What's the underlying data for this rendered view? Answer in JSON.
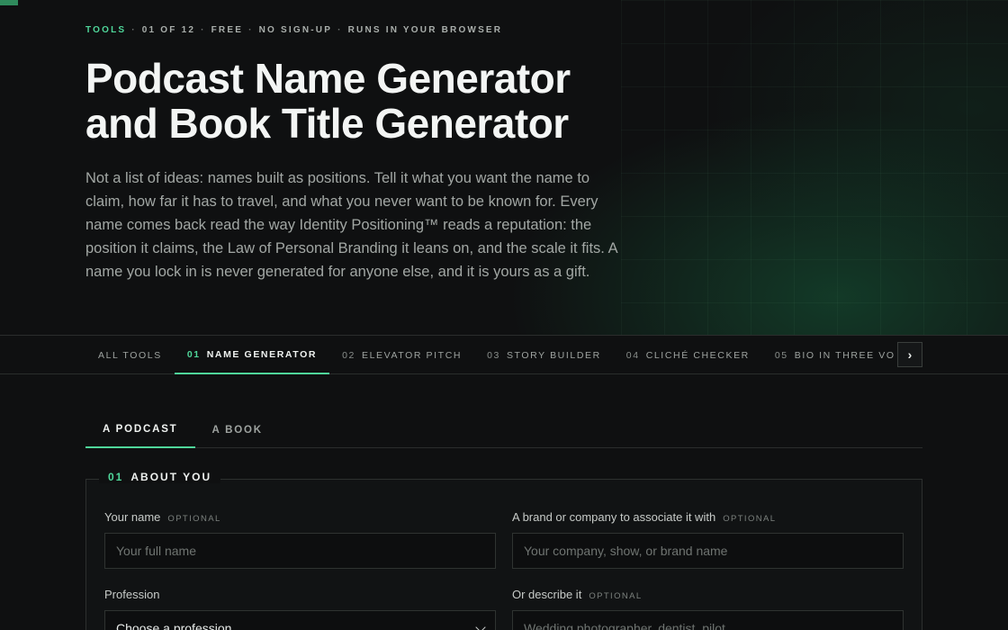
{
  "hero": {
    "eyebrow": {
      "category": "TOOLS",
      "items": [
        "01 OF 12",
        "FREE",
        "NO SIGN-UP",
        "RUNS IN YOUR BROWSER"
      ]
    },
    "title_line1": "Podcast Name Generator",
    "title_line2": "and Book Title Generator",
    "intro": "Not a list of ideas: names built as positions. Tell it what you want the name to claim, how far it has to travel, and what you never want to be known for. Every name comes back read the way Identity Positioning™ reads a reputation: the position it claims, the Law of Personal Branding it leans on, and the scale it fits. A name you lock in is never generated for anyone else, and it is yours as a gift."
  },
  "tool_tabs": [
    {
      "num": "",
      "label": "ALL TOOLS"
    },
    {
      "num": "01",
      "label": "NAME GENERATOR"
    },
    {
      "num": "02",
      "label": "ELEVATOR PITCH"
    },
    {
      "num": "03",
      "label": "STORY BUILDER"
    },
    {
      "num": "04",
      "label": "CLICHÉ CHECKER"
    },
    {
      "num": "05",
      "label": "BIO IN THREE VOICES"
    },
    {
      "num": "06",
      "label": ""
    }
  ],
  "tool_tabs_next_icon": "chevron-right-icon",
  "mode_tabs": [
    {
      "label": "A PODCAST"
    },
    {
      "label": "A BOOK"
    }
  ],
  "section": {
    "num": "01",
    "title": "ABOUT YOU"
  },
  "fields": {
    "name": {
      "label": "Your name",
      "optional": "OPTIONAL",
      "placeholder": "Your full name",
      "value": ""
    },
    "brand": {
      "label": "A brand or company to associate it with",
      "optional": "OPTIONAL",
      "placeholder": "Your company, show, or brand name",
      "value": ""
    },
    "profession": {
      "label": "Profession",
      "selected": "Choose a profession"
    },
    "describe": {
      "label": "Or describe it",
      "optional": "OPTIONAL",
      "placeholder": "Wedding photographer, dentist, pilot",
      "value": ""
    }
  },
  "colors": {
    "accent": "#4fd69a",
    "background": "#0f1011",
    "text": "#f3f5f4",
    "muted": "#a2a7a4"
  }
}
